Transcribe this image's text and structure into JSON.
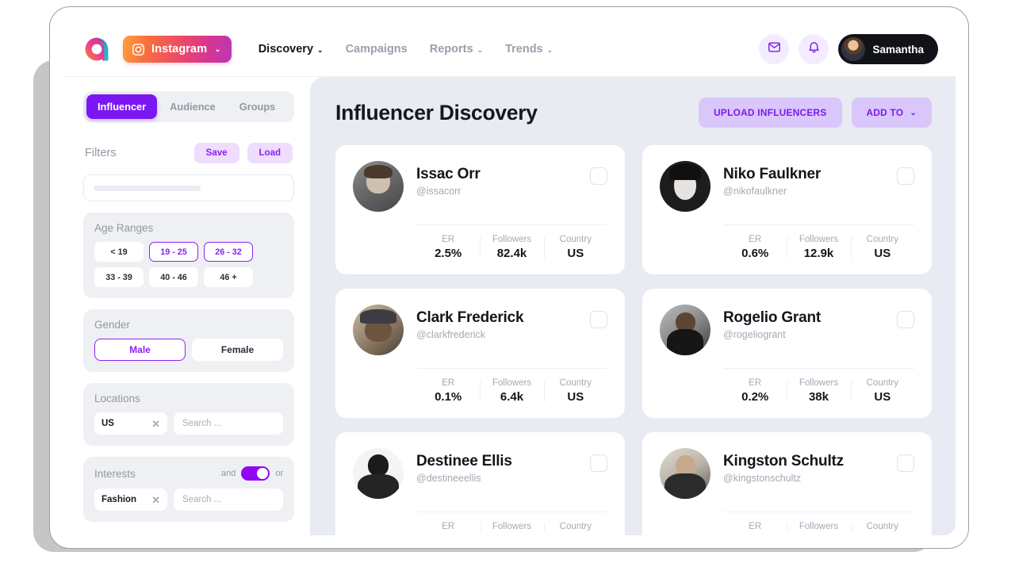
{
  "brand": {
    "logo_icon": "affable-logo-icon"
  },
  "topbar": {
    "platform": {
      "label": "Instagram",
      "icon": "instagram-icon",
      "caret": "⌄"
    },
    "nav": [
      {
        "label": "Discovery",
        "caret": "⌄",
        "active": true
      },
      {
        "label": "Campaigns",
        "caret": "",
        "active": false
      },
      {
        "label": "Reports",
        "caret": "⌄",
        "active": false
      },
      {
        "label": "Trends",
        "caret": "⌄",
        "active": false
      }
    ],
    "mail_icon": "mail-icon",
    "bell_icon": "bell-icon",
    "user": {
      "name": "Samantha",
      "avatar_icon": "user-avatar"
    }
  },
  "sidebar": {
    "segments": [
      {
        "label": "Influencer",
        "active": true
      },
      {
        "label": "Audience",
        "active": false
      },
      {
        "label": "Groups",
        "active": false
      }
    ],
    "filters_label": "Filters",
    "save_label": "Save",
    "load_label": "Load",
    "search_placeholder": "",
    "age": {
      "title": "Age Ranges",
      "options": [
        {
          "label": "< 19",
          "selected": false
        },
        {
          "label": "19 - 25",
          "selected": true
        },
        {
          "label": "26 - 32",
          "selected": true
        },
        {
          "label": "33 - 39",
          "selected": false
        },
        {
          "label": "40 - 46",
          "selected": false
        },
        {
          "label": "46 +",
          "selected": false
        }
      ]
    },
    "gender": {
      "title": "Gender",
      "options": [
        {
          "label": "Male",
          "selected": true
        },
        {
          "label": "Female",
          "selected": false
        }
      ]
    },
    "locations": {
      "title": "Locations",
      "tag": "US",
      "remove_icon": "close-icon",
      "search_placeholder": "Search ..."
    },
    "interests": {
      "title": "Interests",
      "and_label": "and",
      "or_label": "or",
      "toggle_on": true,
      "tag": "Fashion",
      "remove_icon": "close-icon",
      "search_placeholder": "Search ..."
    }
  },
  "main": {
    "title": "Influencer Discovery",
    "upload_label": "UPLOAD INFLUENCERS",
    "add_to_label": "ADD TO",
    "add_to_caret": "⌄",
    "stat_labels": {
      "er": "ER",
      "followers": "Followers",
      "country": "Country"
    },
    "cards": [
      {
        "name": "Issac Orr",
        "handle": "@issacorr",
        "er": "2.5%",
        "followers": "82.4k",
        "country": "US",
        "avatar": "av-a"
      },
      {
        "name": "Niko Faulkner",
        "handle": "@nikofaulkner",
        "er": "0.6%",
        "followers": "12.9k",
        "country": "US",
        "avatar": "av-b"
      },
      {
        "name": "Clark Frederick",
        "handle": "@clarkfrederick",
        "er": "0.1%",
        "followers": "6.4k",
        "country": "US",
        "avatar": "av-c"
      },
      {
        "name": "Rogelio Grant",
        "handle": "@rogeliogrant",
        "er": "0.2%",
        "followers": "38k",
        "country": "US",
        "avatar": "av-d"
      },
      {
        "name": "Destinee Ellis",
        "handle": "@destineeellis",
        "er": "",
        "followers": "",
        "country": "",
        "avatar": "av-e"
      },
      {
        "name": "Kingston Schultz",
        "handle": "@kingstonschultz",
        "er": "",
        "followers": "",
        "country": "",
        "avatar": "av-f"
      }
    ]
  },
  "colors": {
    "accent": "#7b17f2",
    "accent_soft": "#d9c6fa",
    "chip_bg": "#eeddfd",
    "panel_bg": "#e8ebf1",
    "block_bg": "#eef0f4",
    "toggle_on": "#9206f5"
  }
}
